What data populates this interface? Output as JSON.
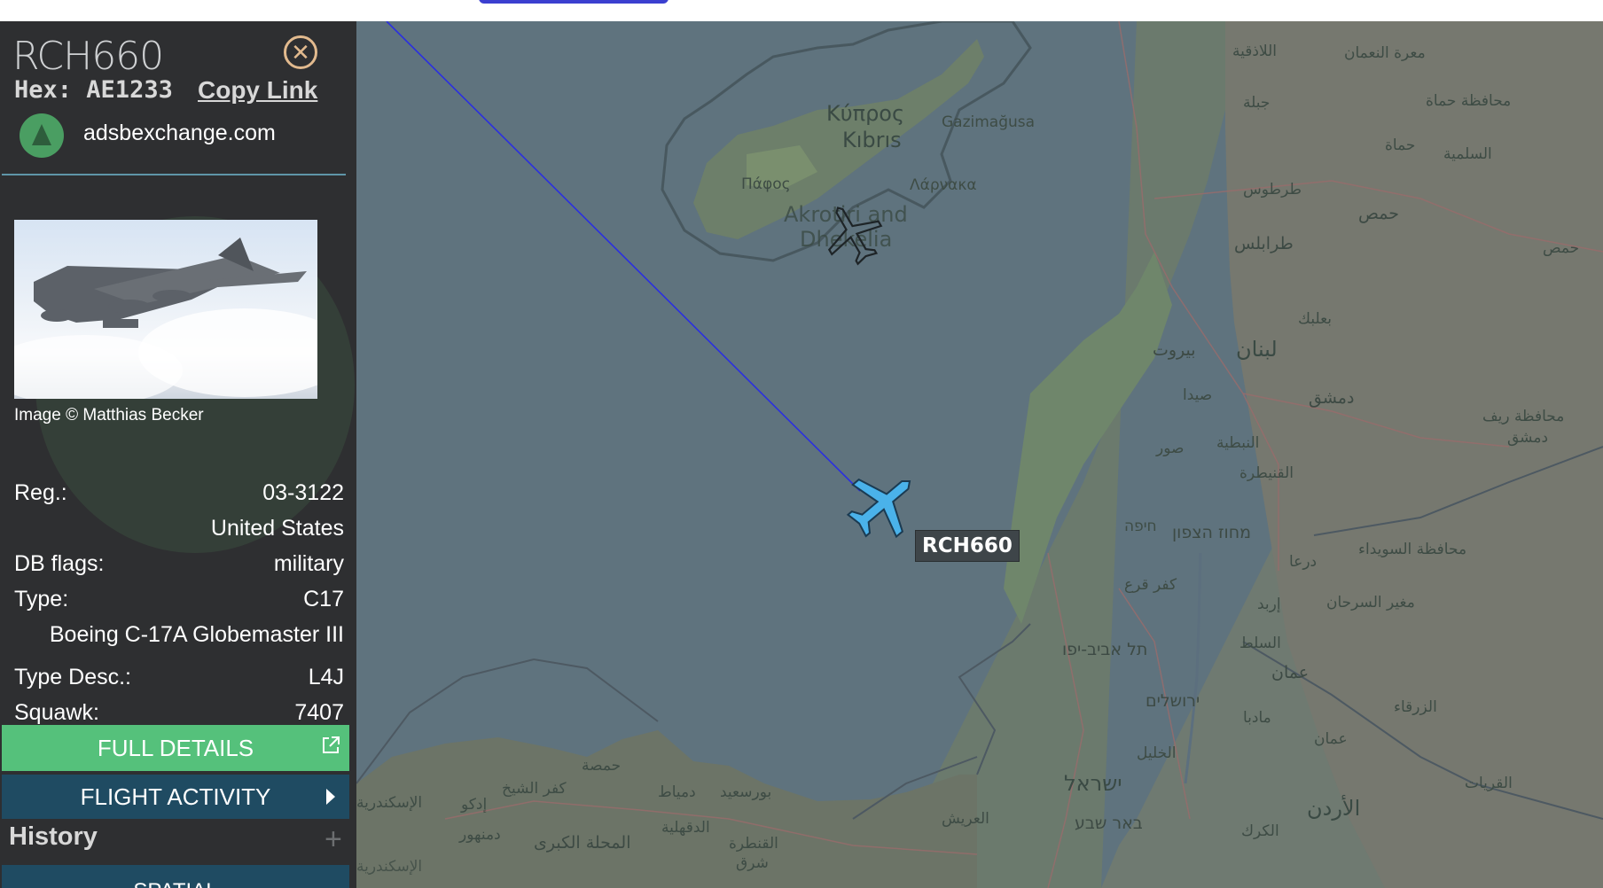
{
  "sidebar": {
    "callsign": "RCH660",
    "hex_label": "Hex:",
    "hex_value": "AE1233",
    "copy_link": "Copy Link",
    "site": "adsbexchange.com",
    "photo_credit": "Image © Matthias Becker",
    "fields": [
      {
        "label": "Reg.:",
        "value": "03-3122"
      },
      {
        "label": "",
        "value": "United States"
      },
      {
        "label": "DB flags:",
        "value": "military"
      },
      {
        "label": "Type:",
        "value": "C17"
      },
      {
        "label": "",
        "value": "Boeing C-17A Globemaster III"
      },
      {
        "label": "Type Desc.:",
        "value": "L4J"
      },
      {
        "label": "Squawk:",
        "value": "7407"
      }
    ],
    "full_details": "FULL DETAILS",
    "flight_activity": "FLIGHT ACTIVITY",
    "history": "History",
    "spatial": "SPATIAL"
  },
  "map": {
    "selected_label": "RCH660",
    "places": {
      "cyprus_gr": "Κύπρος",
      "cyprus_tr": "Kıbrıs",
      "gazimagusa": "Gazimağusa",
      "pafos": "Πάφος",
      "larnaka": "Λάρνακα",
      "akrotiri": "Akrotiri and",
      "dhekelia": "Dhekelia",
      "latakia": "اللاذقية",
      "jableh": "جبلة",
      "tartus": "طرطوس",
      "tripoli": "طرابلس",
      "beirut": "بيروت",
      "lebanon": "لبنان",
      "baalbek": "بعلبك",
      "sidon": "صيدا",
      "tyre": "صور",
      "damascus": "دمشق",
      "homs": "حمص",
      "hama": "حماة",
      "hama_gov": "محافظة حماة",
      "maarat": "معرة النعمان",
      "salamiyah": "السلمية",
      "homs_east": "حمص",
      "rif_dimashq": "محافظة ريف",
      "rif_dimashq2": "دمشق",
      "haifa": "חיפה",
      "north_dist": "מחוז הצפון",
      "tel_aviv": "תל אביב-יפו",
      "jerusalem": "ירושלים",
      "israel": "ישראל",
      "beer_sheva": "באר שבע",
      "amman": "عمان",
      "amman2": "عمان",
      "jordan": "الأردن",
      "irbid": "إربد",
      "zarqa": "الزرقاء",
      "sweida": "محافظة السويداء",
      "mafraq": "مغير السرحان",
      "daraa": "درعا",
      "kerak": "الكرك",
      "qurayyat": "القريات",
      "hebron": "الخليل",
      "alexandria": "الإسكندرية",
      "kafr": "كفر الشيخ",
      "mahalla": "المحلة الكبرى",
      "damietta": "دمياط",
      "port_said": "بورسعيد",
      "arish": "العريش",
      "idku": "إدكو",
      "qantara": "القنطرة",
      "qantara2": "شرق",
      "dakahlia": "الدقهلية",
      "hamoul": "دمنهور",
      "hamam": "حمصة",
      "quneitra": "القنيطرة",
      "nabatieh": "النبطية",
      "kafr_kanna": "كفر قرع",
      "salt": "السلط",
      "madaba": "مادبا",
      "alex2": "الإسكندرية"
    }
  },
  "colors": {
    "sidebar_bg": "#2e2f31",
    "full_details": "#55c17b",
    "activity": "#1f4b62",
    "plane_selected": "#4ab2ea",
    "track": "#2b2fe0",
    "close": "#e2ba8e"
  }
}
